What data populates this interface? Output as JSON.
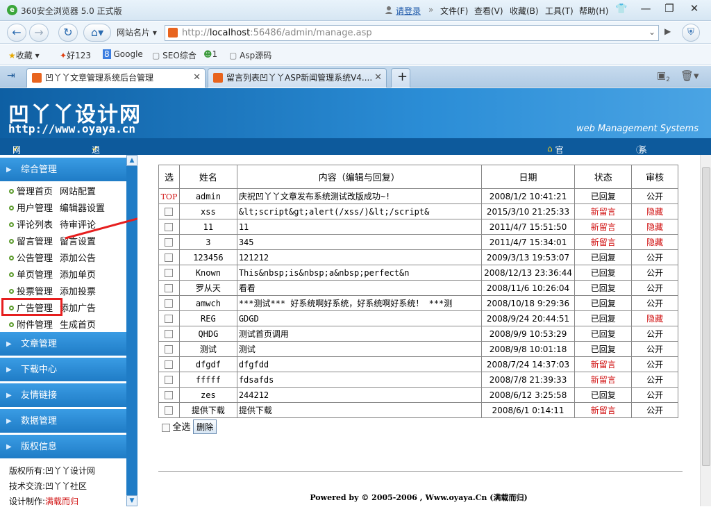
{
  "browser": {
    "title": "360安全浏览器 5.0 正式版",
    "login": "请登录",
    "menu": [
      "文件(F)",
      "查看(V)",
      "收藏(B)",
      "工具(T)",
      "帮助(H)"
    ],
    "site_dropdown": "网站名片",
    "url_prefix": "http://",
    "url_host": "localhost",
    "url_rest": ":56486/admin/manage.asp",
    "favorites": [
      "收藏",
      "好123",
      "Google",
      "SEO综合",
      "1",
      "Asp源码"
    ],
    "tabs": [
      {
        "label": "凹丫丫文章管理系统后台管理",
        "active": true
      },
      {
        "label": "留言列表凹丫丫ASP新闻管理系统V4....",
        "active": false
      }
    ],
    "tab_count": "2"
  },
  "header": {
    "logo": "凹丫丫设计网",
    "url": "http://www.oyaya.cn",
    "subtitle": "web Management Systems",
    "nav_left": [
      "网站首页",
      "退出登陆"
    ],
    "nav_right": [
      "官 方 网 站",
      "系 统 说 明"
    ]
  },
  "sidebar": {
    "sections": [
      "综合管理",
      "文章管理",
      "下载中心",
      "友情链接",
      "数据管理",
      "版权信息"
    ],
    "items": [
      {
        "left": "管理首页",
        "right": "网站配置"
      },
      {
        "left": "用户管理",
        "right": "编辑器设置"
      },
      {
        "left": "评论列表",
        "right": "待审评论"
      },
      {
        "left": "留言管理",
        "right": "留言设置"
      },
      {
        "left": "公告管理",
        "right": "添加公告"
      },
      {
        "left": "单页管理",
        "right": "添加单页"
      },
      {
        "left": "投票管理",
        "right": "添加投票"
      },
      {
        "left": "广告管理",
        "right": "添加广告"
      },
      {
        "left": "附件管理",
        "right": "生成首页"
      }
    ],
    "footer": [
      {
        "label": "版权所有:",
        "value": "凹丫丫设计网"
      },
      {
        "label": "技术交流:",
        "value": "凹丫丫社区"
      },
      {
        "label": "设计制作:",
        "value": "满载而归"
      }
    ]
  },
  "table": {
    "headers": [
      "选",
      "姓名",
      "内容（编辑与回复）",
      "日期",
      "状态",
      "审核"
    ],
    "rows": [
      {
        "sel": "TOP",
        "name": "admin",
        "content": "庆祝凹丫丫文章发布系统测试改版成功~!",
        "date": "2008/1/2 10:41:21",
        "status": "已回复",
        "review": "公开"
      },
      {
        "sel": "",
        "name": "xss",
        "content": "&lt;script&gt;alert(/xss/)&lt;/script&",
        "date": "2015/3/10 21:25:33",
        "status": "新留言",
        "review": "隐藏"
      },
      {
        "sel": "",
        "name": "11",
        "content": "11",
        "date": "2011/4/7 15:51:50",
        "status": "新留言",
        "review": "隐藏"
      },
      {
        "sel": "",
        "name": "3",
        "content": "345",
        "date": "2011/4/7 15:34:01",
        "status": "新留言",
        "review": "隐藏"
      },
      {
        "sel": "",
        "name": "123456",
        "content": "121212",
        "date": "2009/3/13 19:53:07",
        "status": "已回复",
        "review": "公开"
      },
      {
        "sel": "",
        "name": "Known",
        "content": "This&nbsp;is&nbsp;a&nbsp;perfect&n",
        "date": "2008/12/13 23:36:44",
        "status": "已回复",
        "review": "公开"
      },
      {
        "sel": "",
        "name": "罗从天",
        "content": "看看",
        "date": "2008/11/6 10:26:04",
        "status": "已回复",
        "review": "公开"
      },
      {
        "sel": "",
        "name": "amwch",
        "content": "***测试*** 好系统啊好系统，好系统啊好系统！ ***测",
        "date": "2008/10/18 9:29:36",
        "status": "已回复",
        "review": "公开"
      },
      {
        "sel": "",
        "name": "REG",
        "content": "GDGD",
        "date": "2008/9/24 20:44:51",
        "status": "已回复",
        "review": "隐藏"
      },
      {
        "sel": "",
        "name": "QHDG",
        "content": "测试首页调用",
        "date": "2008/9/9 10:53:29",
        "status": "已回复",
        "review": "公开"
      },
      {
        "sel": "",
        "name": "测试",
        "content": "测试",
        "date": "2008/9/8 10:01:18",
        "status": "已回复",
        "review": "公开"
      },
      {
        "sel": "",
        "name": "dfgdf",
        "content": "dfgfdd",
        "date": "2008/7/24 14:37:03",
        "status": "新留言",
        "review": "公开"
      },
      {
        "sel": "",
        "name": "fffff",
        "content": "fdsafds",
        "date": "2008/7/8 21:39:33",
        "status": "新留言",
        "review": "公开"
      },
      {
        "sel": "",
        "name": "zes",
        "content": "244212",
        "date": "2008/6/12 3:25:58",
        "status": "已回复",
        "review": "公开"
      },
      {
        "sel": "",
        "name": "提供下载",
        "content": "提供下载",
        "date": "2008/6/1 0:14:11",
        "status": "新留言",
        "review": "公开"
      }
    ],
    "select_all": "全选",
    "delete_button": "删除"
  },
  "footer": {
    "copyright": "Powered by © 2005-2006 , Www.oyaya.Cn (满载而归)"
  },
  "colors": {
    "accent_red": "#d01010",
    "banner_blue": "#1f7cc6",
    "highlight": "#e61e1e"
  }
}
